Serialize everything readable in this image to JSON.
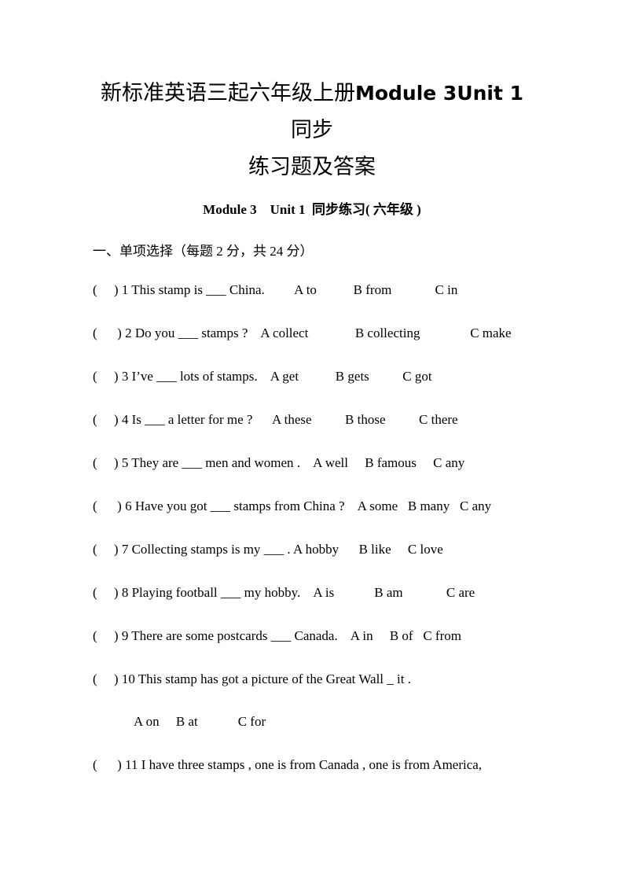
{
  "document": {
    "title_prefix": "新标准英语三起六年级上册",
    "title_bold": "Module 3Unit 1",
    "title_suffix": "同步",
    "title_line2": "练习题及答案",
    "subtitle": "Module 3    Unit 1  同步练习( 六年级 )",
    "section_heading": "一、单项选择（每题 2 分，共 24 分）",
    "questions": [
      {
        "text": "(     ) 1 This stamp is ___ China.         A to           B from             C in"
      },
      {
        "text": "(      ) 2 Do you ___ stamps ?    A collect              B collecting               C make"
      },
      {
        "text": "(     ) 3 I’ve ___ lots of stamps.    A get           B gets          C got"
      },
      {
        "text": "(     ) 4 Is ___ a letter for me ?      A these          B those          C there"
      },
      {
        "text": "(     ) 5 They are ___ men and women .    A well     B famous     C any"
      },
      {
        "text": "(      ) 6 Have you got ___ stamps from China ?    A some   B many   C any"
      },
      {
        "text": "(     ) 7 Collecting stamps is my ___ . A hobby      B like     C love"
      },
      {
        "text": "(     ) 8 Playing football ___ my hobby.    A is            B am             C are"
      },
      {
        "text": "(     ) 9 There are some postcards ___ Canada.    A in     B of   C from"
      },
      {
        "text": "(     ) 10 This stamp has got a picture of the Great Wall _ it .",
        "sub_options": "A on     B at            C for"
      },
      {
        "text": "(      ) 11 I have three stamps , one is from Canada , one is from America,"
      }
    ]
  }
}
